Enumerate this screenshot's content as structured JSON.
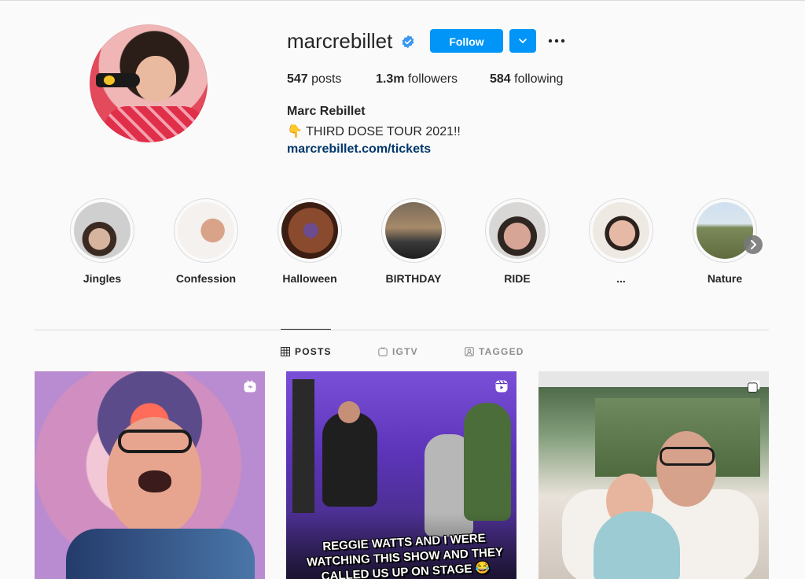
{
  "profile": {
    "username": "marcrebillet",
    "follow_label": "Follow",
    "stats": {
      "posts_value": "547",
      "posts_label": "posts",
      "followers_value": "1.3m",
      "followers_label": "followers",
      "following_value": "584",
      "following_label": "following"
    },
    "full_name": "Marc Rebillet",
    "bio": "👇 THIRD DOSE TOUR 2021!!",
    "link": "marcrebillet.com/tickets"
  },
  "highlights": [
    {
      "label": "Jingles"
    },
    {
      "label": "Confession"
    },
    {
      "label": "Halloween"
    },
    {
      "label": "BIRTHDAY"
    },
    {
      "label": "RIDE"
    },
    {
      "label": "..."
    },
    {
      "label": "Nature"
    }
  ],
  "tabs": [
    {
      "label": "POSTS",
      "active": true
    },
    {
      "label": "IGTV",
      "active": false
    },
    {
      "label": "TAGGED",
      "active": false
    }
  ],
  "posts": [
    {
      "badge_icon": "igtv-icon",
      "caption": ""
    },
    {
      "badge_icon": "reels-icon",
      "caption": "REGGIE WATTS AND I WERE WATCHING THIS SHOW AND THEY CALLED US UP ON STAGE 😂"
    },
    {
      "badge_icon": "carousel-icon",
      "caption": ""
    }
  ],
  "colors": {
    "accent": "#0095f6",
    "link": "#00376b",
    "text": "#262626",
    "muted": "#8e8e8e",
    "background": "#fafafa"
  }
}
